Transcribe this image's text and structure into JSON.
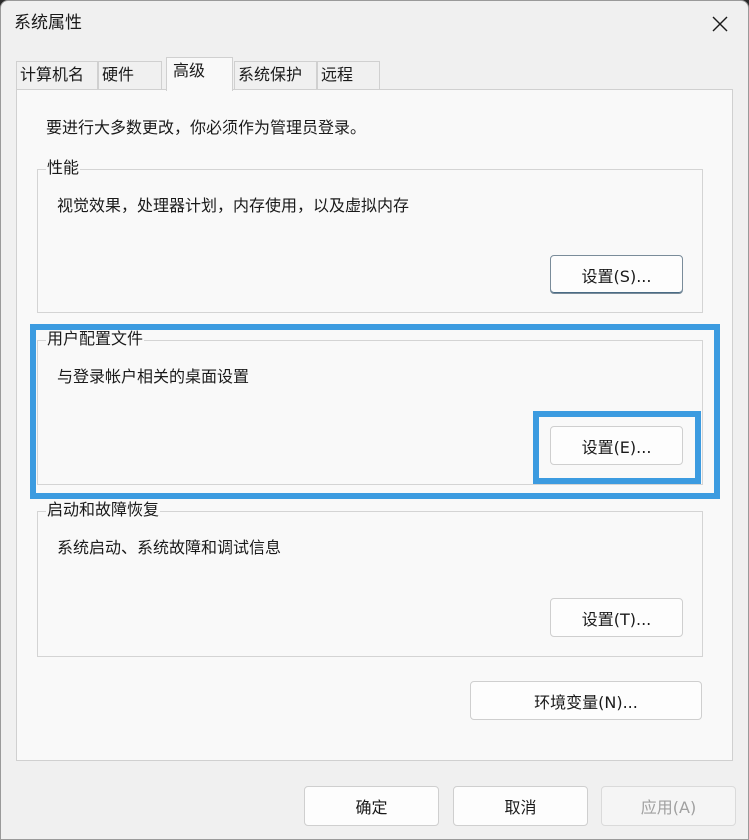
{
  "window": {
    "title": "系统属性"
  },
  "tabs": [
    {
      "label": "计算机名"
    },
    {
      "label": "硬件"
    },
    {
      "label": "高级",
      "active": true
    },
    {
      "label": "系统保护"
    },
    {
      "label": "远程"
    }
  ],
  "advanced": {
    "notice": "要进行大多数更改，你必须作为管理员登录。",
    "performance": {
      "label": "性能",
      "description": "视觉效果，处理器计划，内存使用，以及虚拟内存",
      "button": "设置(S)..."
    },
    "user_profiles": {
      "label": "用户配置文件",
      "description": "与登录帐户相关的桌面设置",
      "button": "设置(E)..."
    },
    "startup_recovery": {
      "label": "启动和故障恢复",
      "description": "系统启动、系统故障和调试信息",
      "button": "设置(T)..."
    },
    "env_button": "环境变量(N)..."
  },
  "footer": {
    "ok": "确定",
    "cancel": "取消",
    "apply": "应用(A)"
  },
  "highlight_color": "#3c9be0"
}
